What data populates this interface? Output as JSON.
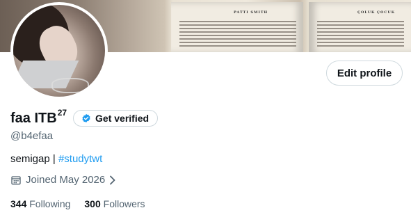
{
  "profile": {
    "display_name": "faa ITB",
    "name_superscript": "27",
    "handle": "@b4efaa",
    "bio_text": "semigap | ",
    "bio_hashtag": "#studytwt",
    "joined": "Joined May 2026",
    "following_count": "344",
    "following_label": "Following",
    "followers_count": "300",
    "followers_label": "Followers"
  },
  "buttons": {
    "edit_profile": "Edit profile",
    "get_verified": "Get verified"
  },
  "banner": {
    "left_page_header": "PATTI SMITH",
    "right_page_header": "ÇOLUK ÇOCUK"
  },
  "icons": {
    "verified_badge": "verified-badge-icon",
    "calendar": "calendar-icon",
    "chevron": "chevron-right-icon"
  },
  "colors": {
    "accent": "#1d9bf0",
    "secondary_text": "#536471",
    "border": "#cfd9de"
  }
}
